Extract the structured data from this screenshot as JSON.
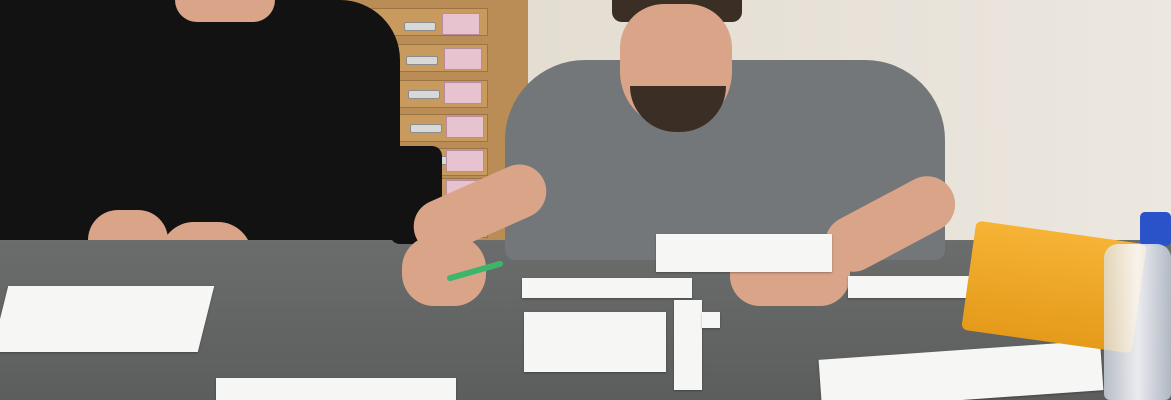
{
  "image": {
    "description": "photo",
    "colors": {
      "wall": "#e6e0d6",
      "cabinet": "#b98d55",
      "table": "#5f6261",
      "paper": "#f6f6f4",
      "folder": "#f0a82a",
      "bottle_cap": "#2a52c9",
      "pencil": "#3fb56b"
    }
  }
}
